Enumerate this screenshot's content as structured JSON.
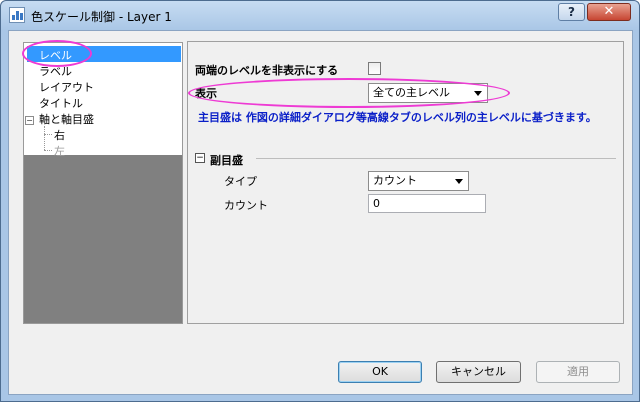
{
  "window": {
    "title": "色スケール制御 - Layer 1",
    "help_label": "?",
    "close_label": "✕"
  },
  "tree": {
    "items": [
      {
        "label": "レベル",
        "selected": true
      },
      {
        "label": "ラベル"
      },
      {
        "label": "レイアウト"
      },
      {
        "label": "タイトル"
      },
      {
        "label": "軸と軸目盛",
        "expander": "□"
      },
      {
        "label": "右"
      },
      {
        "label": "左",
        "disabled": true
      }
    ]
  },
  "panel": {
    "hide_ends_label": "両端のレベルを非表示にする",
    "display_label": "表示",
    "display_value": "全ての主レベル",
    "note": "主目盛は 作図の詳細ダイアログ等高線タブのレベル列の主レベルに基づきます。",
    "minor_section": {
      "toggle": "⊟",
      "title": "副目盛",
      "type_label": "タイプ",
      "type_value": "カウント",
      "count_label": "カウント",
      "count_value": "0"
    }
  },
  "buttons": {
    "ok": "OK",
    "cancel": "キャンセル",
    "apply": "適用"
  },
  "colors": {
    "selection": "#3399ff",
    "highlight": "#ee3ad4",
    "note_text": "#0a1fc8"
  }
}
